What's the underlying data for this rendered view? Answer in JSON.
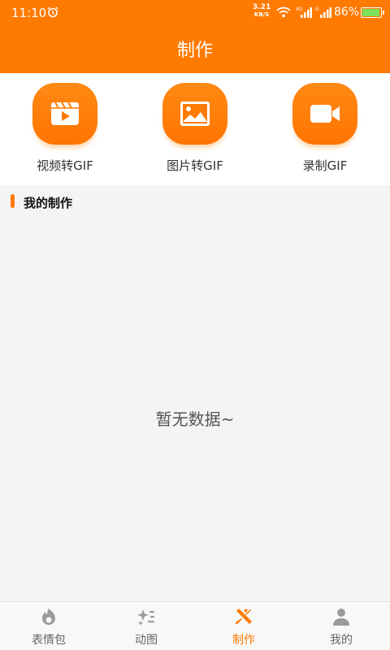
{
  "status_bar": {
    "time": "11:10",
    "net_speed_value": "3.21",
    "net_speed_unit": "KB/S",
    "battery_pct": "86%",
    "battery_level": 0.86
  },
  "header": {
    "title": "制作"
  },
  "tools": [
    {
      "label": "视频转GIF",
      "icon": "video-play-icon"
    },
    {
      "label": "图片转GIF",
      "icon": "image-icon"
    },
    {
      "label": "录制GIF",
      "icon": "video-camera-icon"
    }
  ],
  "section": {
    "title": "我的制作"
  },
  "empty_state": {
    "text": "暂无数据~"
  },
  "tabbar": {
    "items": [
      {
        "label": "表情包",
        "icon": "sticker-icon",
        "active": false
      },
      {
        "label": "动图",
        "icon": "sparkle-list-icon",
        "active": false
      },
      {
        "label": "制作",
        "icon": "make-tools-icon",
        "active": true
      },
      {
        "label": "我的",
        "icon": "user-icon",
        "active": false
      }
    ]
  },
  "colors": {
    "accent": "#ff7a00",
    "background": "#f4f4f4",
    "tab_inactive": "#999999"
  }
}
